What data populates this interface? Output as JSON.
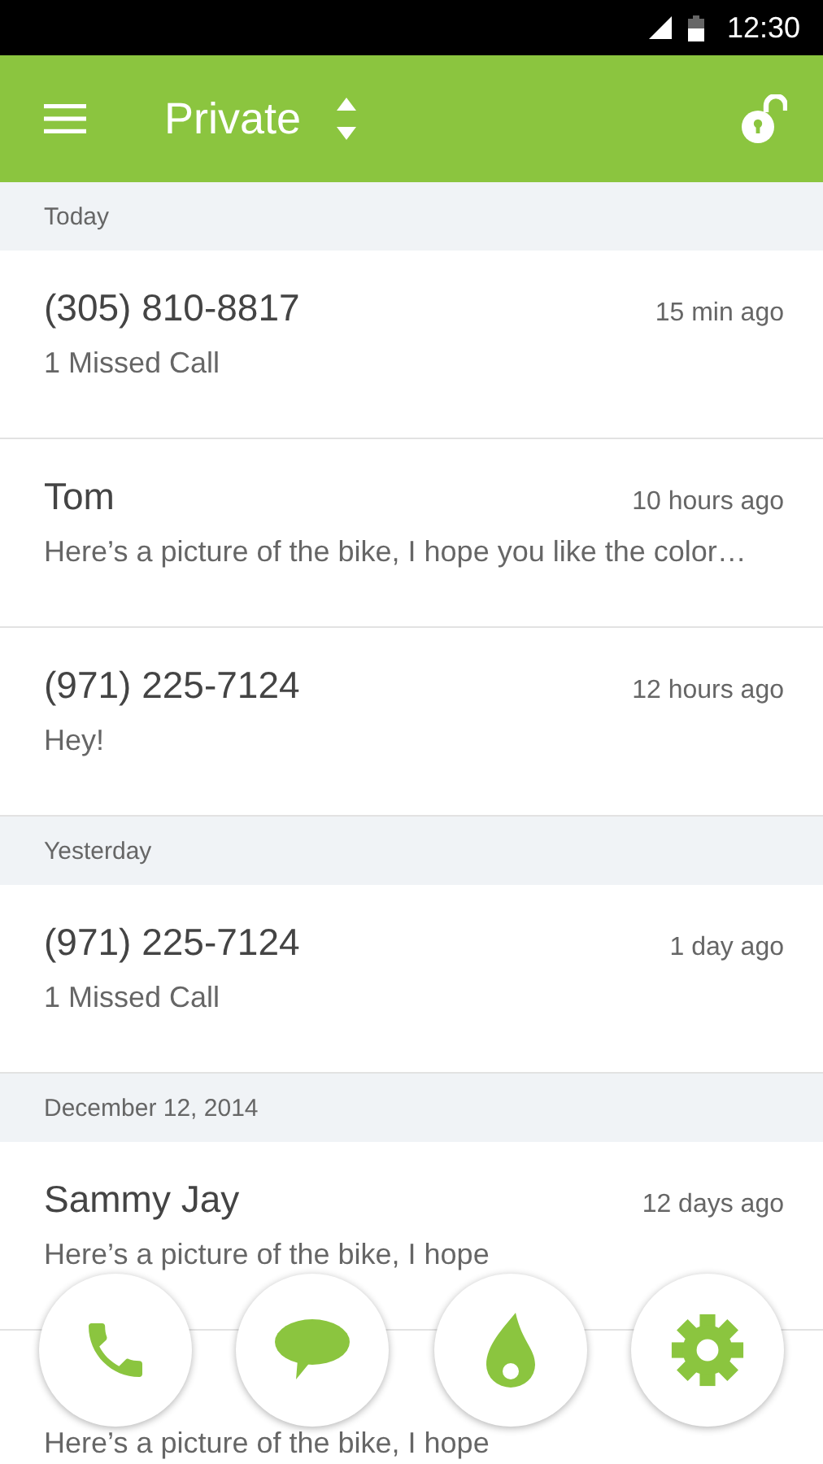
{
  "status_bar": {
    "time": "12:30"
  },
  "header": {
    "title": "Private"
  },
  "sections": [
    {
      "label": "Today",
      "items": [
        {
          "title": "(305) 810-8817",
          "time": "15 min ago",
          "preview": "1 Missed Call"
        },
        {
          "title": "Tom",
          "time": "10 hours ago",
          "preview": "Here’s a picture of the bike, I hope you like the color…"
        },
        {
          "title": "(971) 225-7124",
          "time": "12 hours ago",
          "preview": "Hey!"
        }
      ]
    },
    {
      "label": "Yesterday",
      "items": [
        {
          "title": "(971) 225-7124",
          "time": "1 day ago",
          "preview": "1 Missed Call"
        }
      ]
    },
    {
      "label": "December 12, 2014",
      "items": [
        {
          "title": "Sammy Jay",
          "time": "12 days ago",
          "preview": "Here’s a picture of the bike, I hope"
        },
        {
          "preview": "Here’s a picture of the bike, I hope"
        }
      ]
    }
  ],
  "actions": [
    {
      "kind": "phone"
    },
    {
      "kind": "message"
    },
    {
      "kind": "flame"
    },
    {
      "kind": "settings"
    }
  ]
}
